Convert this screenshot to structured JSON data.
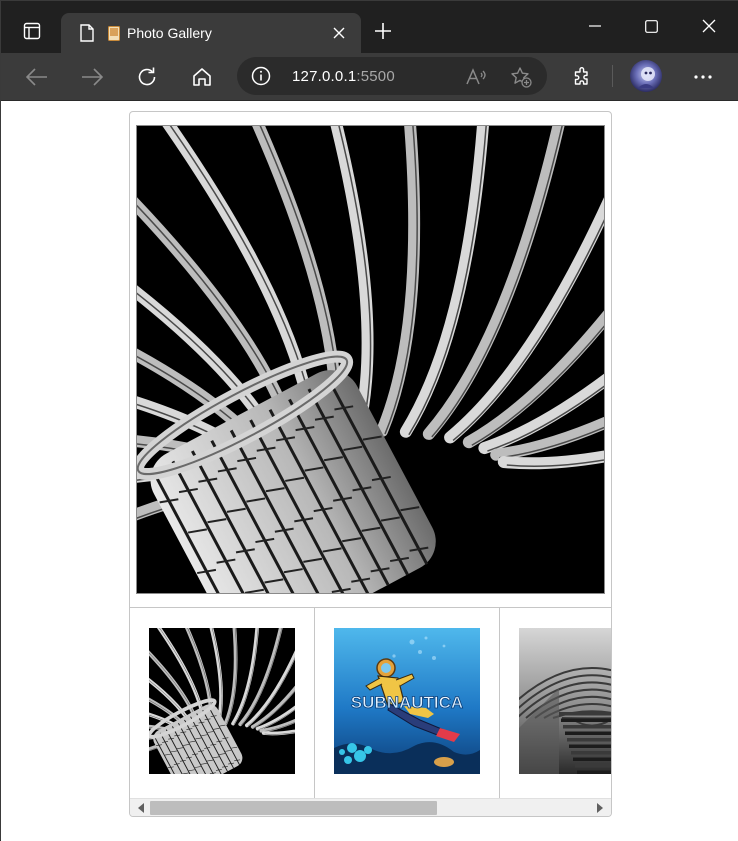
{
  "browser": {
    "tab": {
      "title": "Photo Gallery",
      "page_icon": "page-icon",
      "favicon": "photo-favicon"
    },
    "address": {
      "host": "127.0.0.1",
      "port": ":5500"
    },
    "icons": [
      "tab-actions-icon",
      "close-icon",
      "new-tab-icon",
      "minimize-icon",
      "maximize-icon",
      "window-close-icon",
      "back-icon",
      "forward-icon",
      "refresh-icon",
      "home-icon",
      "info-icon",
      "read-aloud-icon",
      "add-favorite-icon",
      "extensions-icon",
      "profile-avatar",
      "more-icon"
    ],
    "colors": {
      "tabstrip": "#202020",
      "toolbar": "#3b3b3b",
      "address_bg": "#2b2b2b"
    }
  },
  "gallery": {
    "main_photo": {
      "subject": "black and white radiating curved metal pipes"
    },
    "thumbnails": [
      {
        "subject": "radiating curved metal pipes"
      },
      {
        "subject": "Subnautica diver underwater",
        "caption": "SUBNAUTICA"
      },
      {
        "subject": "arched corridor with staircase"
      }
    ],
    "scrollbar": {
      "position": 0.6
    }
  }
}
